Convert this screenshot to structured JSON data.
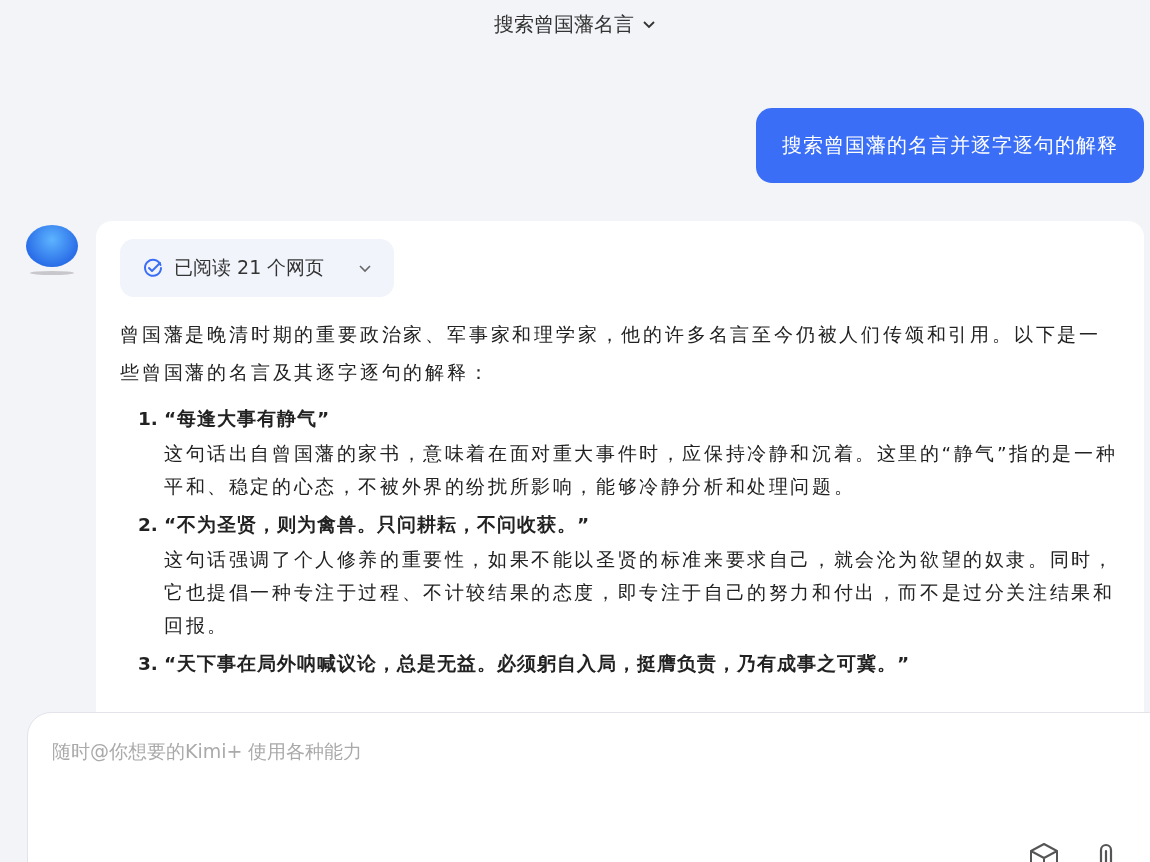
{
  "header": {
    "title": "搜索曾国藩名言"
  },
  "messages": [
    {
      "kind": "user",
      "text": "搜索曾国藩的名言并逐字逐句的解释"
    },
    {
      "kind": "assistant",
      "sources": {
        "label": "已阅读 21 个网页",
        "expanded": false
      },
      "intro": "曾国藩是晚清时期的重要政治家、军事家和理学家，他的许多名言至今仍被人们传颂和引用。以下是一些曾国藩的名言及其逐字逐句的解释：",
      "items": [
        {
          "number": "1.",
          "quote": "“每逢大事有静气”",
          "explanation": "这句话出自曾国藩的家书，意味着在面对重大事件时，应保持冷静和沉着。这里的“静气”指的是一种平和、稳定的心态，不被外界的纷扰所影响，能够冷静分析和处理问题。"
        },
        {
          "number": "2.",
          "quote": "“不为圣贤，则为禽兽。只问耕耘，不问收获。”",
          "explanation": "这句话强调了个人修养的重要性，如果不能以圣贤的标准来要求自己，就会沦为欲望的奴隶。同时，它也提倡一种专注于过程、不计较结果的态度，即专注于自己的努力和付出，而不是过分关注结果和回报。"
        },
        {
          "number": "3.",
          "quote": "“天下事在局外呐喊议论，总是无益。必须躬自入局，挺膺负责，乃有成事之可冀。”"
        }
      ]
    }
  ],
  "composer": {
    "placeholder": "随时@你想要的Kimi+ 使用各种能力"
  }
}
